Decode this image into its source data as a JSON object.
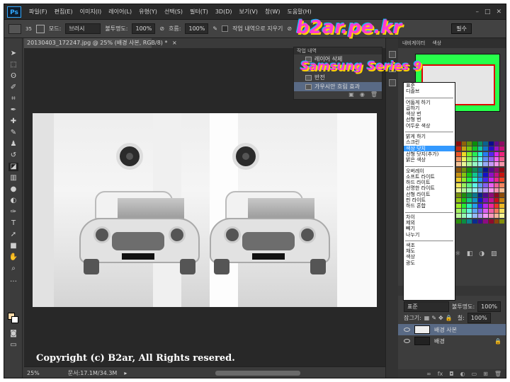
{
  "app": {
    "logo": "Ps"
  },
  "menu": [
    "파일(F)",
    "편집(E)",
    "이미지(I)",
    "레이어(L)",
    "유형(Y)",
    "선택(S)",
    "필터(T)",
    "3D(D)",
    "보기(V)",
    "창(W)",
    "도움말(H)"
  ],
  "window_controls": {
    "minimize": "–",
    "maximize": "□",
    "close": "✕"
  },
  "options": {
    "brush_size": "35",
    "mode_label": "모드:",
    "mode_value": "브러시",
    "opacity_label": "불투명도:",
    "opacity_value": "100%",
    "flow_label": "흐름:",
    "flow_value": "100%",
    "erase_history_label": "작업 내역으로 지우기",
    "workspace": "필수"
  },
  "document": {
    "tab_title": "20130403_172247.jpg @ 25% (배경 사본, RGB/8) *",
    "close": "×",
    "zoom": "25%",
    "doc_size": "문서:17.1M/34.3M",
    "copyright": "Copyright (c) B2ar, All Rights resered."
  },
  "history_panel": {
    "tabs": "작업 내역",
    "items": [
      "레이어 삭제",
      "레이어 복제",
      "반전",
      "가우시안 흐림 효과"
    ],
    "selected_index": 3
  },
  "right_panel": {
    "tabs": [
      "내비게이터",
      "색상"
    ]
  },
  "blend_dropdown": {
    "groups": [
      [
        "표준",
        "디졸브"
      ],
      [
        "어둡게 하기",
        "곱하기",
        "색상 번",
        "선형 번",
        "어두운 색상"
      ],
      [
        "밝게 하기",
        "스크린",
        "색상 닷지",
        "선형 닷지(추가)",
        "밝은 색상"
      ],
      [
        "오버레이",
        "소프트 라이트",
        "하드 라이트",
        "선명한 라이트",
        "선형 라이트",
        "핀 라이트",
        "하드 혼합"
      ],
      [
        "차이",
        "제외",
        "빼기",
        "나누기"
      ],
      [
        "색조",
        "채도",
        "색상",
        "광도"
      ]
    ],
    "selected": "색상 닷지"
  },
  "layers": {
    "blend_value": "표준",
    "opacity_label": "불투명도:",
    "opacity_value": "100%",
    "lock_label": "잠그기:",
    "fill_label": "칠:",
    "fill_value": "100%",
    "items": [
      {
        "name": "배경 사본",
        "selected": true
      },
      {
        "name": "배경",
        "selected": false
      }
    ]
  },
  "watermark": {
    "line1": "b2ar.pe.kr",
    "line2": "Samsung Series 9"
  },
  "colors": {
    "selection": "#596a85",
    "dropdown_highlight": "#3399ff",
    "nav_border": "#27ff4b"
  }
}
